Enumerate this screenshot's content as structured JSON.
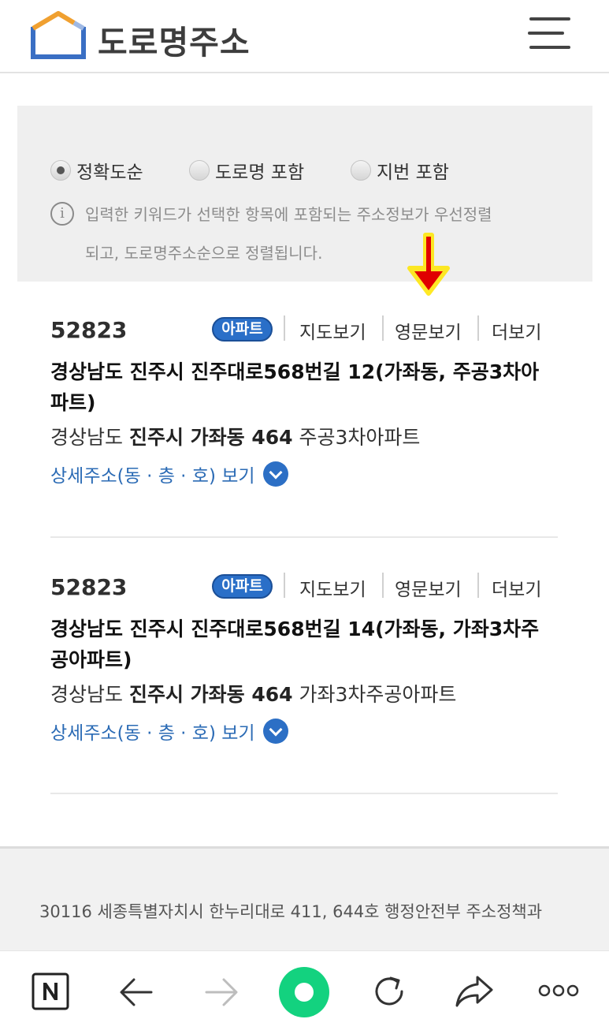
{
  "header": {
    "logo_text": "도로명주소",
    "menu_icon": "hamburger-menu-icon"
  },
  "filter": {
    "options": [
      {
        "label": "정확도순",
        "selected": true
      },
      {
        "label": "도로명 포함",
        "selected": false
      },
      {
        "label": "지번 포함",
        "selected": false
      }
    ],
    "info_icon": "info-circle-icon",
    "info_line1": "입력한 키워드가 선택한 항목에 포함되는 주소정보가 우선정렬",
    "info_line2": "되고, 도로명주소순으로 정렬됩니다."
  },
  "annotation": {
    "icon": "red-down-arrow-icon",
    "color": "#e00000"
  },
  "results": [
    {
      "zip": "52823",
      "badge": "아파트",
      "actions": [
        "지도보기",
        "영문보기",
        "더보기"
      ],
      "road_line1": "경상남도 진주시 진주대로568번길 12(가좌동, 주공3차아",
      "road_line2": "파트)",
      "jibun_prefix": "경상남도",
      "jibun_bold": "진주시 가좌동 464",
      "jibun_suffix": "주공3차아파트",
      "detail_label": "상세주소(동 · 층 · 호) 보기"
    },
    {
      "zip": "52823",
      "badge": "아파트",
      "actions": [
        "지도보기",
        "영문보기",
        "더보기"
      ],
      "road_line1": "경상남도 진주시 진주대로568번길 14(가좌동, 가좌3차주",
      "road_line2": "공아파트)",
      "jibun_prefix": "경상남도",
      "jibun_bold": "진주시 가좌동 464",
      "jibun_suffix": "가좌3차주공아파트",
      "detail_label": "상세주소(동 · 층 · 호) 보기"
    }
  ],
  "footer": {
    "address": "30116 세종특별자치시 한누리대로 411, 644호 행정안전부 주소정책과"
  },
  "bottom_bar": {
    "items": [
      "naver-n-icon",
      "back-arrow-icon",
      "forward-arrow-icon",
      "home-circle-icon",
      "refresh-icon",
      "share-icon",
      "more-dots-icon"
    ],
    "accent": "#13d27f"
  },
  "colors": {
    "link_blue": "#2b6bb5",
    "badge_blue": "#2a6fc8",
    "logo_orange": "#f0a030",
    "logo_blue": "#3a6fc4"
  }
}
